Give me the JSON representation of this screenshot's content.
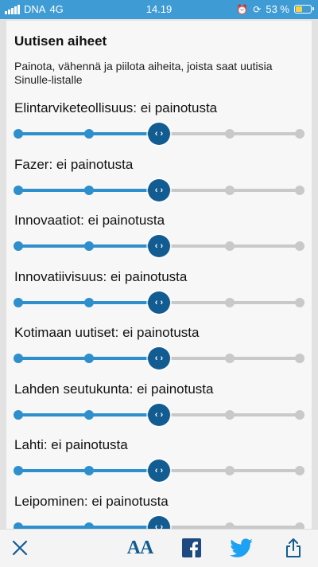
{
  "status_bar": {
    "carrier": "DNA",
    "network": "4G",
    "time": "14.19",
    "battery_percent": "53 %",
    "battery_level": 0.53
  },
  "panel": {
    "heading": "Uutisen aiheet",
    "description": "Painota, vähennä ja piilota aiheita, joista saat uutisia Sinulle-listalle"
  },
  "topics": [
    {
      "label": "Elintarviketeollisuus: ei painotusta",
      "position": 2,
      "steps": 5
    },
    {
      "label": "Fazer: ei painotusta",
      "position": 2,
      "steps": 5
    },
    {
      "label": "Innovaatiot: ei painotusta",
      "position": 2,
      "steps": 5
    },
    {
      "label": "Innovatiivisuus: ei painotusta",
      "position": 2,
      "steps": 5
    },
    {
      "label": "Kotimaan uutiset: ei painotusta",
      "position": 2,
      "steps": 5
    },
    {
      "label": "Lahden seutukunta: ei painotusta",
      "position": 2,
      "steps": 5
    },
    {
      "label": "Lahti: ei painotusta",
      "position": 2,
      "steps": 5
    },
    {
      "label": "Leipominen: ei painotusta",
      "position": 2,
      "steps": 5
    }
  ],
  "slider_knob_glyph": "‹ ›",
  "toolbar": {
    "close_icon": "close-icon",
    "text_size_label": "AA",
    "facebook_icon": "facebook-icon",
    "twitter_icon": "twitter-icon",
    "share_icon": "share-icon"
  },
  "colors": {
    "status_bar": "#3f9bd4",
    "accent": "#2f8fcc",
    "knob": "#125c92",
    "inactive": "#c9c9c9",
    "facebook": "#1d4a80",
    "twitter": "#1da1f2"
  }
}
